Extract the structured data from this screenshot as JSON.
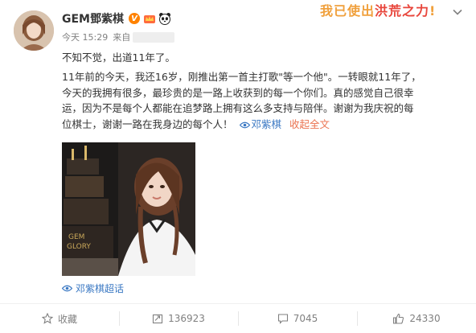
{
  "post": {
    "username": "GEM鄧紫棋",
    "vip_badge": "V",
    "banner_prefix": "我已使出",
    "banner_highlight": "洪荒之力",
    "banner_suffix": "!",
    "time": "今天 15:29",
    "source_label": "来自",
    "paragraph1": "不知不觉，出道11年了。",
    "line1": "11年前的今天，我还16岁，刚推出第一首主打歌\"等一个他\"。一转眼就11年了，",
    "line2": "今天的我拥有很多，最珍贵的是一路上收获到的每一个你们。真的感觉自己很幸",
    "line3": "运，因为不是每个人都能在追梦路上拥有这么多支持与陪伴。谢谢为我庆祝的每",
    "line4": "位棋士，谢谢一路在我身边的每个人！",
    "topic_link": "邓紫棋",
    "expand_label": "收起全文",
    "supertopic": "邓紫棋超话"
  },
  "footer": {
    "favorite_label": "收藏",
    "repost_count": "136923",
    "comment_count": "7045",
    "like_count": "24330"
  },
  "colors": {
    "link": "#eb7350",
    "topic": "#3a78c3",
    "muted": "#808080",
    "vip": "#ff8200"
  },
  "icons": [
    "star-icon",
    "repost-icon",
    "comment-icon",
    "like-icon",
    "chevron-down-icon",
    "eye-icon",
    "crown-icon",
    "panda-icon"
  ]
}
